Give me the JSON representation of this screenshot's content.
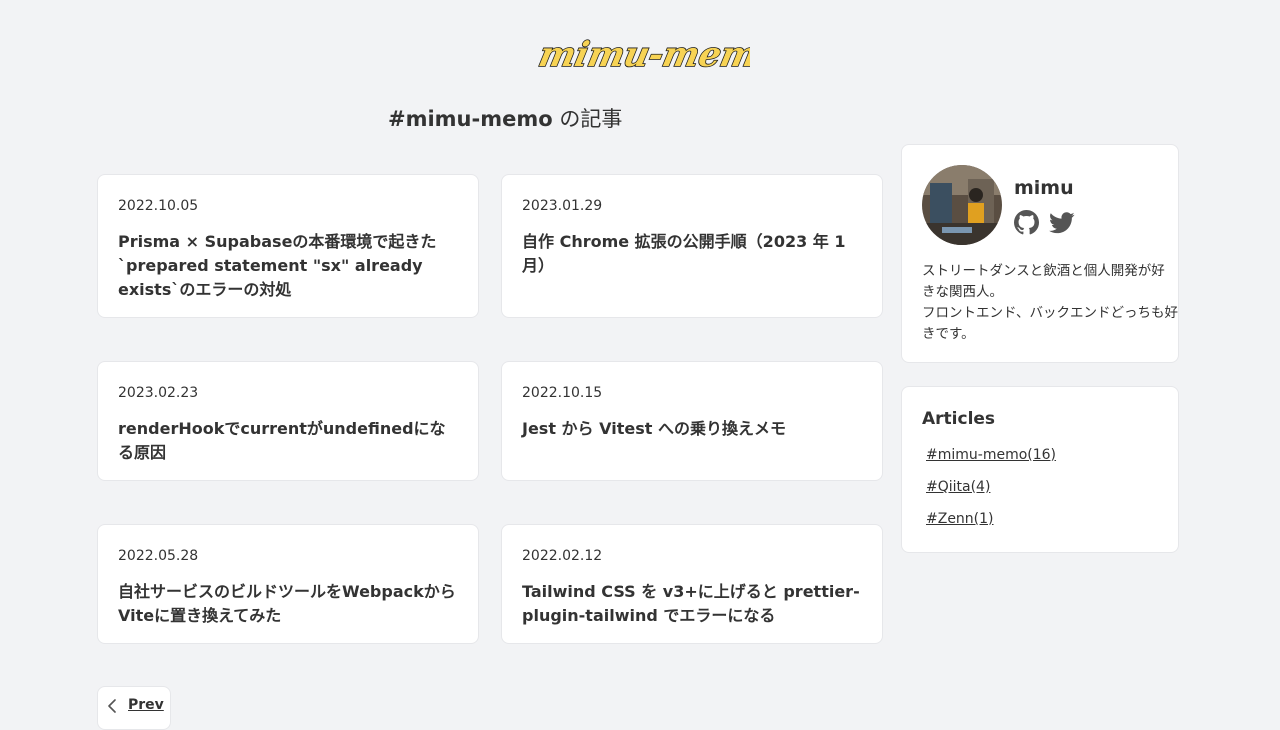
{
  "site": {
    "logo_text": "mimu-memo"
  },
  "page": {
    "heading_tag": "#mimu-memo",
    "heading_suffix": " の記事"
  },
  "articles": [
    {
      "date": "2022.10.05",
      "title": "Prisma × Supabaseの本番環境で起きた`prepared statement \"sx\" already exists`のエラーの対処"
    },
    {
      "date": "2023.01.29",
      "title": "自作 Chrome 拡張の公開手順（2023 年 1 月）"
    },
    {
      "date": "2023.02.23",
      "title": "renderHookでcurrentがundefinedになる原因"
    },
    {
      "date": "2022.10.15",
      "title": "Jest から Vitest への乗り換えメモ"
    },
    {
      "date": "2022.05.28",
      "title": "自社サービスのビルドツールをWebpackからViteに置き換えてみた"
    },
    {
      "date": "2022.02.12",
      "title": "Tailwind CSS を v3+に上げると prettier-plugin-tailwind でエラーになる"
    }
  ],
  "profile": {
    "name": "mimu",
    "bio_line1": "ストリートダンスと飲酒と個人開発が好きな関西人。",
    "bio_line2": "フロントエンド、バックエンドどっちも好きです。"
  },
  "sidebar_articles": {
    "heading": "Articles",
    "tags": [
      "#mimu-memo(16)",
      "#Qiita(4)",
      "#Zenn(1)"
    ]
  },
  "pagination": {
    "prev_label": "Prev"
  },
  "colors": {
    "logo_fill": "#f7d354",
    "background": "#f2f3f5",
    "icon": "#555555"
  }
}
